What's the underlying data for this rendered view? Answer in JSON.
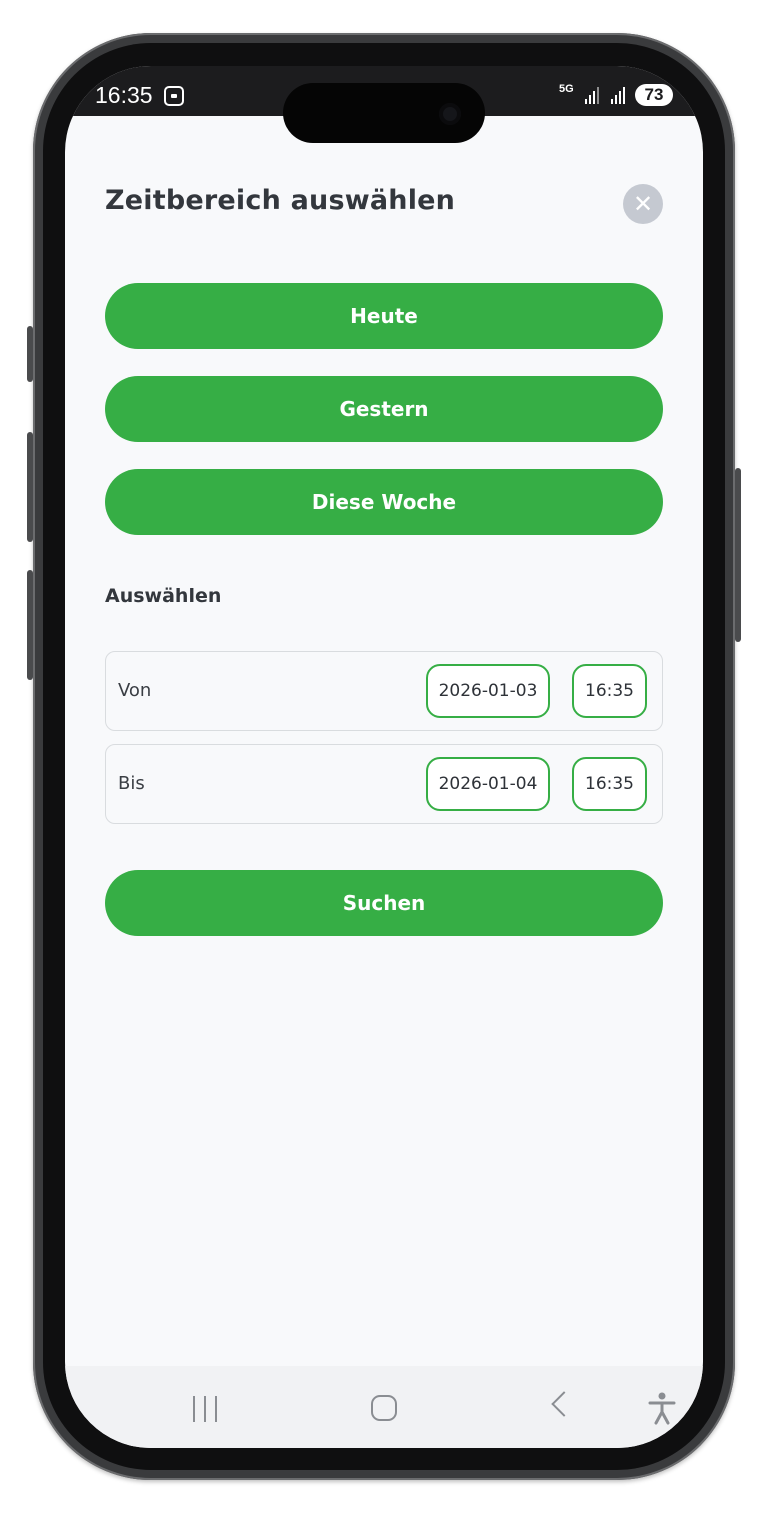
{
  "status_bar": {
    "time": "16:35",
    "network": "5G",
    "battery": "73"
  },
  "dialog": {
    "title": "Zeitbereich auswählen",
    "close_icon": "close-icon",
    "quick_buttons": [
      {
        "label": "Heute"
      },
      {
        "label": "Gestern"
      },
      {
        "label": "Diese Woche"
      }
    ],
    "section_label": "Auswählen",
    "range": {
      "from": {
        "label": "Von",
        "date": "2026-01-03",
        "time": "16:35"
      },
      "to": {
        "label": "Bis",
        "date": "2026-01-04",
        "time": "16:35"
      }
    },
    "search_label": "Suchen"
  },
  "nav_bar": {
    "icons": [
      "recents-icon",
      "home-icon",
      "back-icon",
      "accessibility-icon"
    ]
  },
  "colors": {
    "accent": "#36ae45",
    "title_text": "#33373d",
    "close_bg": "#c5c9d1",
    "screen_bg": "#f8f9fb"
  }
}
